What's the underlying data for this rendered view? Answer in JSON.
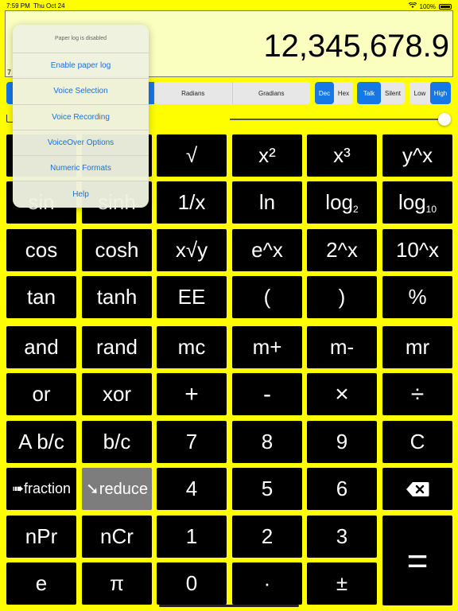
{
  "status": {
    "time": "7:59 PM",
    "date": "Thu Oct 24",
    "battery": "100%"
  },
  "display": {
    "value": "12,345,678.9",
    "sub_left": "7"
  },
  "modes": {
    "angle": [
      {
        "label": "Radians",
        "selected": false
      },
      {
        "label": "Gradians",
        "selected": false
      }
    ],
    "base": [
      {
        "label": "Dec",
        "selected": true
      },
      {
        "label": "Hex",
        "selected": false
      }
    ],
    "voice": [
      {
        "label": "Talk",
        "selected": true
      },
      {
        "label": "Silent",
        "selected": false
      }
    ],
    "precision": [
      {
        "label": "Low",
        "selected": false
      },
      {
        "label": "High",
        "selected": true
      }
    ]
  },
  "slider": {
    "value": 1.0
  },
  "menu": {
    "header": "Paper log is disabled",
    "items": [
      "Enable paper log",
      "Voice Selection",
      "Voice Recording",
      "VoiceOver Options",
      "Numeric Formats",
      "Help"
    ]
  },
  "keys": {
    "sqrt": "√",
    "x2": "x²",
    "x3": "x³",
    "yx": "y^x",
    "sin": "sin",
    "sinh": "sinh",
    "inv": "1/x",
    "ln": "ln",
    "log2": "log",
    "log2_sub": "2",
    "log10": "log",
    "log10_sub": "10",
    "cos": "cos",
    "cosh": "cosh",
    "xrooty": "x√y",
    "ex": "e^x",
    "twox": "2^x",
    "tenx": "10^x",
    "tan": "tan",
    "tanh": "tanh",
    "ee": "EE",
    "lparen": "(",
    "rparen": ")",
    "pct": "%",
    "and": "and",
    "rand": "rand",
    "mc": "mc",
    "mplus": "m+",
    "mminus": "m-",
    "mr": "mr",
    "or": "or",
    "xor": "xor",
    "plus": "+",
    "minus": "-",
    "times": "×",
    "divide": "÷",
    "abc": "A b/c",
    "bc": "b/c",
    "d7": "7",
    "d8": "8",
    "d9": "9",
    "clear": "C",
    "fraction": "➠fraction",
    "reduce": "➘reduce",
    "d4": "4",
    "d5": "5",
    "d6": "6",
    "backspace": "⌫",
    "npr": "nPr",
    "ncr": "nCr",
    "d1": "1",
    "d2": "2",
    "d3": "3",
    "equals": "=",
    "e": "e",
    "pi": "π",
    "d0": "0",
    "dot": "·",
    "plusminus": "±"
  }
}
